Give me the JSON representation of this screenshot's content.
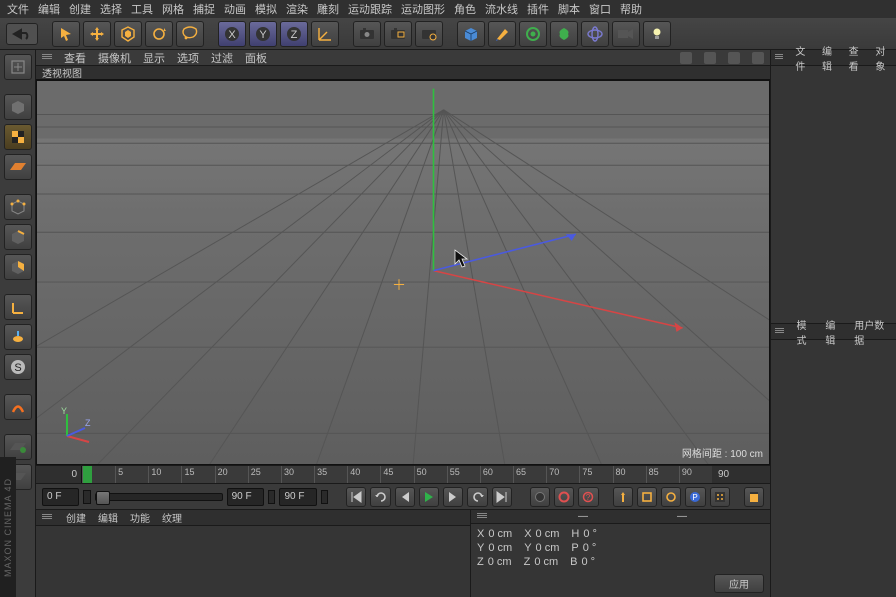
{
  "menu": [
    "文件",
    "编辑",
    "创建",
    "选择",
    "工具",
    "网格",
    "捕捉",
    "动画",
    "模拟",
    "渲染",
    "雕刻",
    "运动跟踪",
    "运动图形",
    "角色",
    "流水线",
    "插件",
    "脚本",
    "窗口",
    "帮助"
  ],
  "vp_menu": [
    "查看",
    "摄像机",
    "显示",
    "选项",
    "过滤",
    "面板"
  ],
  "vp_title": "透视视图",
  "grid_info": "网格间距 : 100 cm",
  "timeline": {
    "labels": [
      "0",
      "5",
      "10",
      "15",
      "20",
      "25",
      "30",
      "35",
      "40",
      "45",
      "50",
      "55",
      "60",
      "65",
      "70",
      "75",
      "80",
      "85",
      "90"
    ],
    "start": "0 F",
    "end": "90 F",
    "range_end": "90 F"
  },
  "panels_right": [
    [
      "文件",
      "编辑",
      "查看",
      "对象"
    ],
    [
      "模式",
      "编辑",
      "用户数据"
    ]
  ],
  "bottom_left_tabs": [
    "创建",
    "编辑",
    "功能",
    "纹理"
  ],
  "coords": {
    "rows": [
      {
        "l1": "X",
        "v1": "0 cm",
        "l2": "X",
        "v2": "0 cm",
        "l3": "H",
        "v3": "0 °"
      },
      {
        "l1": "Y",
        "v1": "0 cm",
        "l2": "Y",
        "v2": "0 cm",
        "l3": "P",
        "v3": "0 °"
      },
      {
        "l1": "Z",
        "v1": "0 cm",
        "l2": "Z",
        "v2": "0 cm",
        "l3": "B",
        "v3": "0 °"
      }
    ],
    "apply": "应用"
  },
  "brand": "MAXON CINEMA 4D",
  "mini_axis": {
    "y": "Y",
    "z": "Z"
  }
}
